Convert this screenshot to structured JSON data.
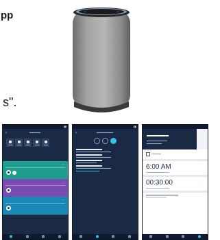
{
  "fragments": {
    "top_left": "pp",
    "mid_left": "s\"."
  },
  "images": {
    "speaker": {
      "kind": "smart speaker product photo"
    }
  },
  "phones": [
    {
      "id": "phone-1",
      "cards": [
        {
          "color": "#1f9e8f"
        },
        {
          "color": "#7a4bb0"
        },
        {
          "color": "#1889b5"
        }
      ]
    },
    {
      "id": "phone-2"
    },
    {
      "id": "phone-3",
      "time_1": "6:00 AM",
      "time_2": "00:30:00"
    }
  ],
  "colors": {
    "phone_bg": "#1b2a44",
    "accent": "#34c3e8"
  }
}
